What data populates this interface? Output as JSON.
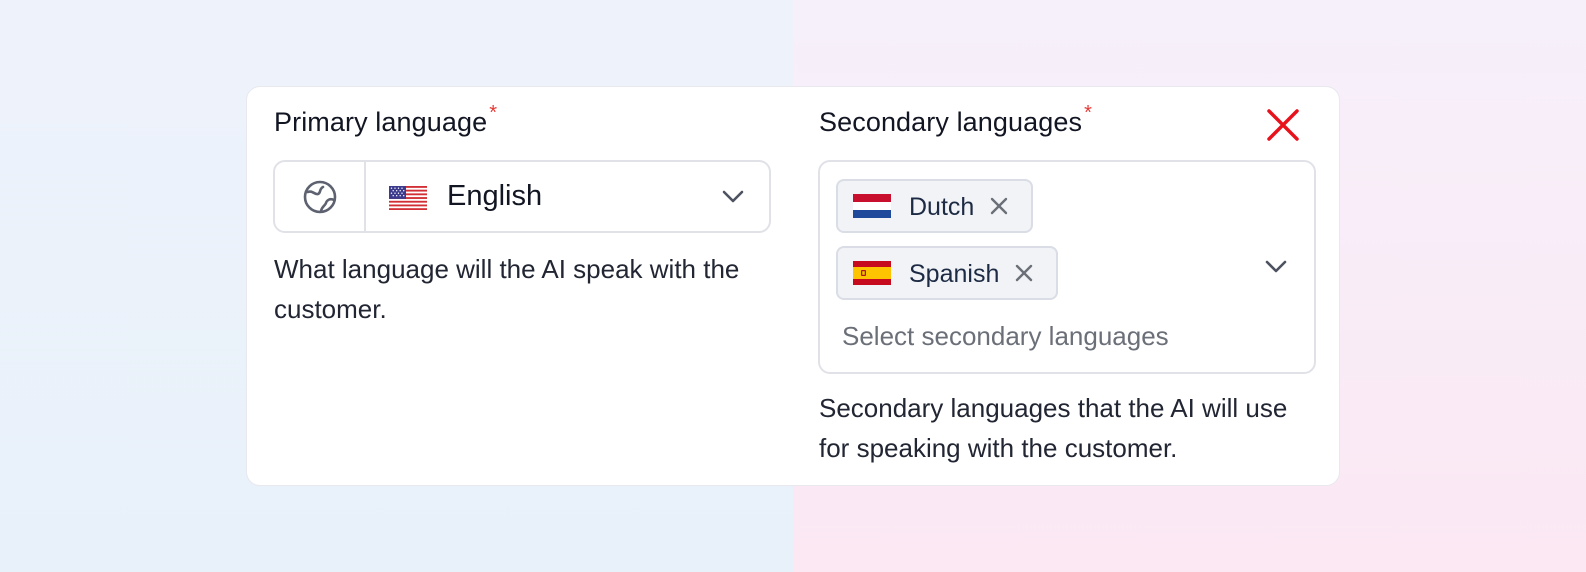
{
  "primary": {
    "label": "Primary language",
    "required_mark": "*",
    "selected_value": "English",
    "flag_icon": "us-flag-icon",
    "leading_icon": "globe-icon",
    "helper": "What language will the AI speak with the customer."
  },
  "secondary": {
    "label": "Secondary languages",
    "required_mark": "*",
    "chips": [
      {
        "label": "Dutch",
        "flag_icon": "netherlands-flag-icon"
      },
      {
        "label": "Spanish",
        "flag_icon": "spain-flag-icon"
      }
    ],
    "placeholder": "Select secondary languages",
    "helper": "Secondary languages that the AI will use for speaking with the customer."
  },
  "colors": {
    "required": "#e53935",
    "close": "#e8121c",
    "border": "#e1e2e8",
    "chip_bg": "#f1f3f6"
  }
}
